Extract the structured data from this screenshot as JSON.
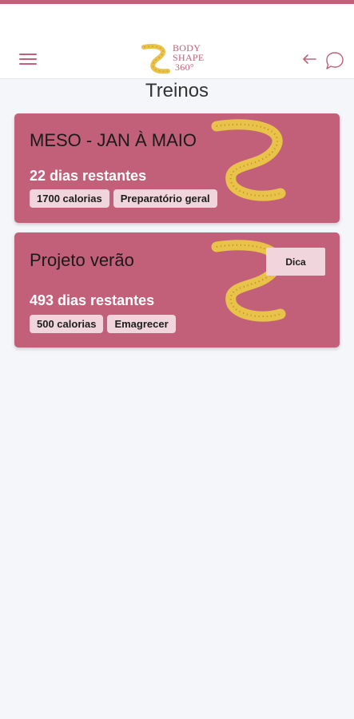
{
  "header": {
    "logo_lines": [
      "BODY",
      "SHAPE",
      "360°"
    ],
    "menu_icon": "hamburger-menu-icon",
    "back_icon": "arrow-left-icon",
    "chat_icon": "chat-bubble-icon"
  },
  "page": {
    "title": "Treinos"
  },
  "workouts": [
    {
      "title": "MESO - JAN À MAIO",
      "remaining": "22 dias restantes",
      "tags": [
        "1700 calorias",
        "Preparatório geral"
      ]
    },
    {
      "title": "Projeto verão",
      "remaining": "493 dias restantes",
      "tags": [
        "500 calorias",
        "Emagrecer"
      ],
      "tip_label": "Dica"
    }
  ],
  "colors": {
    "brand": "#c2607a",
    "chip_bg": "#f0d6dc",
    "tape_gold": "#e9c24a",
    "background": "#f4f6fa"
  }
}
